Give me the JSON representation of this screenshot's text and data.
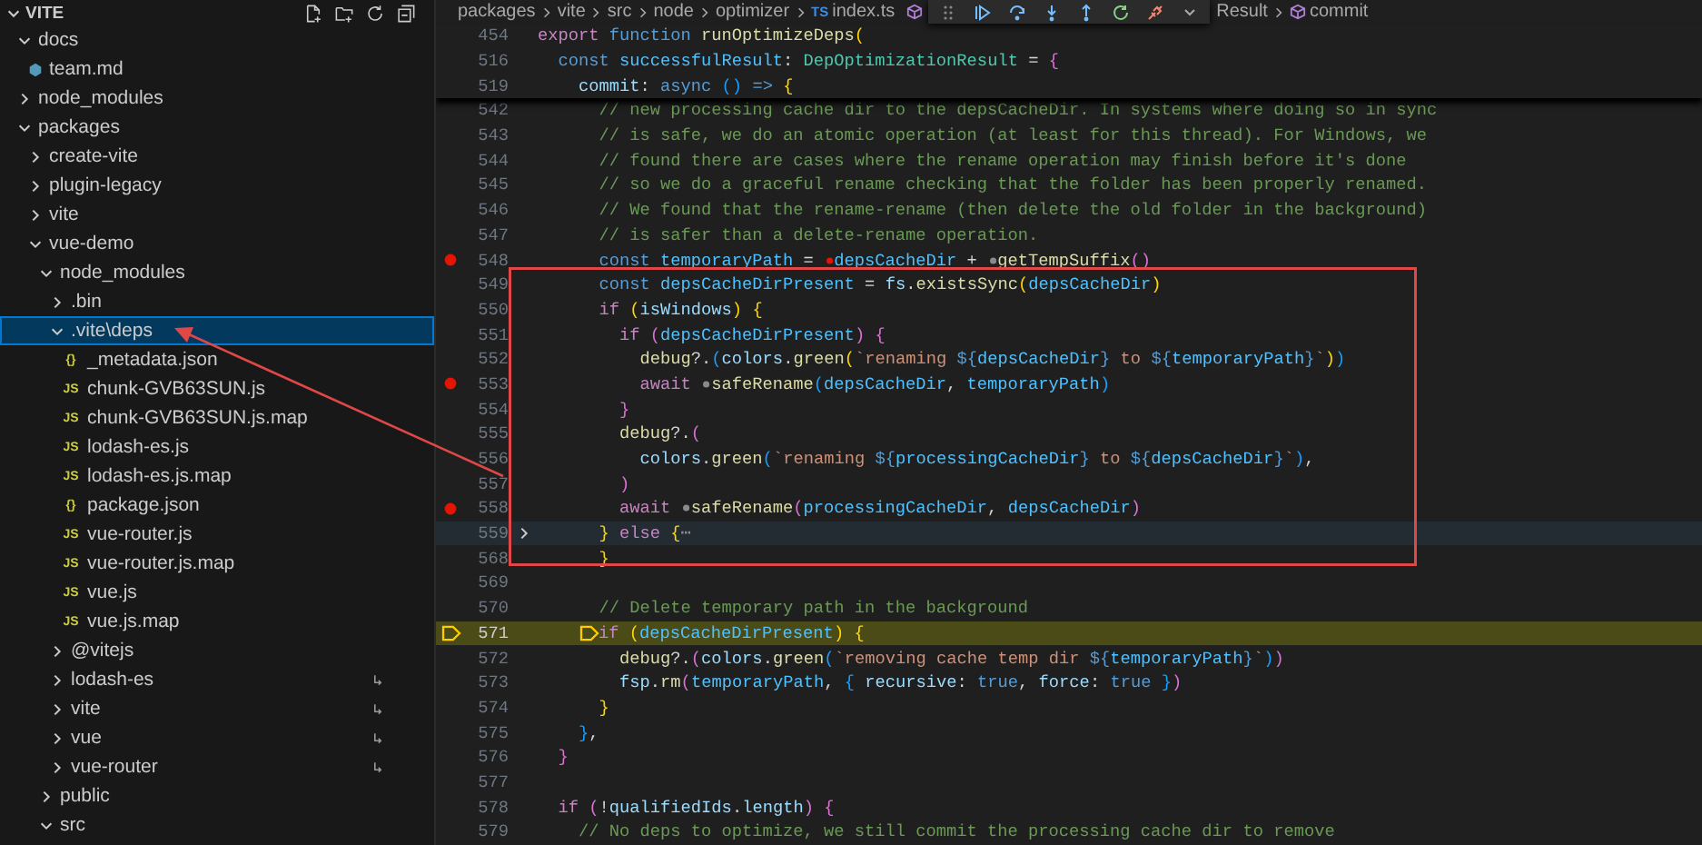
{
  "explorer": {
    "title": "VITE",
    "tree": [
      {
        "label": "docs",
        "kind": "folder",
        "expanded": true,
        "selected": false,
        "children": [
          {
            "label": "team.md",
            "kind": "file",
            "selected": false
          }
        ]
      },
      {
        "label": "node_modules",
        "kind": "folder",
        "expanded": false,
        "selected": false
      },
      {
        "label": "packages",
        "kind": "folder",
        "expanded": true,
        "selected": false,
        "children": [
          {
            "label": "create-vite",
            "kind": "folder",
            "expanded": false,
            "selected": false
          },
          {
            "label": "plugin-legacy",
            "kind": "folder",
            "expanded": false,
            "selected": false
          },
          {
            "label": "vite",
            "kind": "folder",
            "expanded": false,
            "selected": false
          },
          {
            "label": "vue-demo",
            "kind": "folder",
            "expanded": true,
            "selected": false,
            "children": [
              {
                "label": "node_modules",
                "kind": "folder",
                "expanded": true,
                "selected": false,
                "children": [
                  {
                    "label": ".bin",
                    "kind": "folder",
                    "expanded": false,
                    "selected": false,
                    "link": false
                  },
                  {
                    "label": ".vite\\deps",
                    "kind": "folder",
                    "expanded": true,
                    "selected": true,
                    "link": false,
                    "children": [
                      {
                        "label": "_metadata.json",
                        "kind": "file",
                        "badge": "{}",
                        "selected": false
                      },
                      {
                        "label": "chunk-GVB63SUN.js",
                        "kind": "file",
                        "badge": "JS",
                        "selected": false
                      },
                      {
                        "label": "chunk-GVB63SUN.js.map",
                        "kind": "file",
                        "badge": "JS",
                        "selected": false
                      },
                      {
                        "label": "lodash-es.js",
                        "kind": "file",
                        "badge": "JS",
                        "selected": false
                      },
                      {
                        "label": "lodash-es.js.map",
                        "kind": "file",
                        "badge": "JS",
                        "selected": false
                      },
                      {
                        "label": "package.json",
                        "kind": "file",
                        "badge": "{}",
                        "selected": false
                      },
                      {
                        "label": "vue-router.js",
                        "kind": "file",
                        "badge": "JS",
                        "selected": false
                      },
                      {
                        "label": "vue-router.js.map",
                        "kind": "file",
                        "badge": "JS",
                        "selected": false
                      },
                      {
                        "label": "vue.js",
                        "kind": "file",
                        "badge": "JS",
                        "selected": false
                      },
                      {
                        "label": "vue.js.map",
                        "kind": "file",
                        "badge": "JS",
                        "selected": false
                      }
                    ]
                  },
                  {
                    "label": "@vitejs",
                    "kind": "folder",
                    "expanded": false,
                    "selected": false,
                    "link": false
                  },
                  {
                    "label": "lodash-es",
                    "kind": "folder",
                    "expanded": false,
                    "selected": false,
                    "link": true
                  },
                  {
                    "label": "vite",
                    "kind": "folder",
                    "expanded": false,
                    "selected": false,
                    "link": true
                  },
                  {
                    "label": "vue",
                    "kind": "folder",
                    "expanded": false,
                    "selected": false,
                    "link": true
                  },
                  {
                    "label": "vue-router",
                    "kind": "folder",
                    "expanded": false,
                    "selected": false,
                    "link": true
                  }
                ]
              },
              {
                "label": "public",
                "kind": "folder",
                "expanded": false,
                "selected": false
              },
              {
                "label": "src",
                "kind": "folder",
                "expanded": true,
                "selected": false
              }
            ]
          }
        ]
      }
    ]
  },
  "breadcrumbs": [
    {
      "label": "packages",
      "kind": "folder"
    },
    {
      "label": "vite",
      "kind": "folder"
    },
    {
      "label": "src",
      "kind": "folder"
    },
    {
      "label": "node",
      "kind": "folder"
    },
    {
      "label": "optimizer",
      "kind": "folder"
    },
    {
      "label": "index.ts",
      "kind": "file",
      "badge": "TS"
    },
    {
      "label": "Result",
      "kind": "text"
    },
    {
      "label": "commit",
      "kind": "symbol"
    }
  ],
  "sticky_lines": [
    {
      "number": "454",
      "tokens": [
        {
          "kind": "cf",
          "text": "export "
        },
        {
          "kind": "kw",
          "text": "function "
        },
        {
          "kind": "fn",
          "text": "runOptimizeDeps"
        },
        {
          "kind": "b1",
          "text": "("
        }
      ]
    },
    {
      "number": "516",
      "tokens": [
        {
          "kind": "kw",
          "text": "  const "
        },
        {
          "kind": "const",
          "text": "successfulResult"
        },
        {
          "kind": "p",
          "text": ": "
        },
        {
          "kind": "type",
          "text": "DepOptimizationResult"
        },
        {
          "kind": "p",
          "text": " = "
        },
        {
          "kind": "b2",
          "text": "{"
        }
      ]
    },
    {
      "number": "519",
      "tokens": [
        {
          "kind": "var",
          "text": "    commit"
        },
        {
          "kind": "p",
          "text": ": "
        },
        {
          "kind": "kw",
          "text": "async "
        },
        {
          "kind": "b3",
          "text": "()"
        },
        {
          "kind": "kw",
          "text": " => "
        },
        {
          "kind": "b1",
          "text": "{"
        }
      ]
    }
  ],
  "lines": [
    {
      "number": "542",
      "breakpoint": false,
      "current": false,
      "folded": false,
      "tokens": [
        {
          "kind": "com",
          "text": "      // new processing cache dir to the depsCacheDir. In systems where doing so in sync"
        }
      ]
    },
    {
      "number": "543",
      "breakpoint": false,
      "current": false,
      "folded": false,
      "tokens": [
        {
          "kind": "com",
          "text": "      // is safe, we do an atomic operation (at least for this thread). For Windows, we"
        }
      ]
    },
    {
      "number": "544",
      "breakpoint": false,
      "current": false,
      "folded": false,
      "tokens": [
        {
          "kind": "com",
          "text": "      // found there are cases where the rename operation may finish before it's done"
        }
      ]
    },
    {
      "number": "545",
      "breakpoint": false,
      "current": false,
      "folded": false,
      "tokens": [
        {
          "kind": "com",
          "text": "      // so we do a graceful rename checking that the folder has been properly renamed."
        }
      ]
    },
    {
      "number": "546",
      "breakpoint": false,
      "current": false,
      "folded": false,
      "tokens": [
        {
          "kind": "com",
          "text": "      // We found that the rename-rename (then delete the old folder in the background)"
        }
      ]
    },
    {
      "number": "547",
      "breakpoint": false,
      "current": false,
      "folded": false,
      "tokens": [
        {
          "kind": "com",
          "text": "      // is safer than a delete-rename operation."
        }
      ]
    },
    {
      "number": "548",
      "breakpoint": true,
      "current": false,
      "folded": false,
      "tokens": [
        {
          "kind": "kw",
          "text": "      const "
        },
        {
          "kind": "const",
          "text": "temporaryPath"
        },
        {
          "kind": "p",
          "text": " = "
        },
        {
          "kind": "bp",
          "active": true
        },
        {
          "kind": "const",
          "text": "depsCacheDir"
        },
        {
          "kind": "p",
          "text": " + "
        },
        {
          "kind": "bp",
          "active": false
        },
        {
          "kind": "fn",
          "text": "getTempSuffix"
        },
        {
          "kind": "b2",
          "text": "()"
        }
      ]
    },
    {
      "number": "549",
      "breakpoint": false,
      "current": false,
      "folded": false,
      "tokens": [
        {
          "kind": "kw",
          "text": "      const "
        },
        {
          "kind": "const",
          "text": "depsCacheDirPresent"
        },
        {
          "kind": "p",
          "text": " = "
        },
        {
          "kind": "var",
          "text": "fs"
        },
        {
          "kind": "p",
          "text": "."
        },
        {
          "kind": "fn",
          "text": "existsSync"
        },
        {
          "kind": "b1",
          "text": "("
        },
        {
          "kind": "const",
          "text": "depsCacheDir"
        },
        {
          "kind": "b1",
          "text": ")"
        }
      ]
    },
    {
      "number": "550",
      "breakpoint": false,
      "current": false,
      "folded": false,
      "tokens": [
        {
          "kind": "cf",
          "text": "      if "
        },
        {
          "kind": "b1",
          "text": "("
        },
        {
          "kind": "var",
          "text": "isWindows"
        },
        {
          "kind": "b1",
          "text": ") "
        },
        {
          "kind": "b1",
          "text": "{"
        }
      ]
    },
    {
      "number": "551",
      "breakpoint": false,
      "current": false,
      "folded": false,
      "tokens": [
        {
          "kind": "cf",
          "text": "        if "
        },
        {
          "kind": "b2",
          "text": "("
        },
        {
          "kind": "const",
          "text": "depsCacheDirPresent"
        },
        {
          "kind": "b2",
          "text": ") "
        },
        {
          "kind": "b2",
          "text": "{"
        }
      ]
    },
    {
      "number": "552",
      "breakpoint": false,
      "current": false,
      "folded": false,
      "tokens": [
        {
          "kind": "fn",
          "text": "          debug"
        },
        {
          "kind": "p",
          "text": "?."
        },
        {
          "kind": "b3",
          "text": "("
        },
        {
          "kind": "var",
          "text": "colors"
        },
        {
          "kind": "p",
          "text": "."
        },
        {
          "kind": "fn",
          "text": "green"
        },
        {
          "kind": "b1",
          "text": "("
        },
        {
          "kind": "str",
          "text": "`renaming "
        },
        {
          "kind": "tpl",
          "text": "${"
        },
        {
          "kind": "const",
          "text": "depsCacheDir"
        },
        {
          "kind": "tpl",
          "text": "}"
        },
        {
          "kind": "str",
          "text": " to "
        },
        {
          "kind": "tpl",
          "text": "${"
        },
        {
          "kind": "const",
          "text": "temporaryPath"
        },
        {
          "kind": "tpl",
          "text": "}"
        },
        {
          "kind": "str",
          "text": "`"
        },
        {
          "kind": "b1",
          "text": ")"
        },
        {
          "kind": "b3",
          "text": ")"
        }
      ]
    },
    {
      "number": "553",
      "breakpoint": true,
      "current": false,
      "folded": false,
      "tokens": [
        {
          "kind": "cf",
          "text": "          await "
        },
        {
          "kind": "bp",
          "active": false
        },
        {
          "kind": "fn",
          "text": "safeRename"
        },
        {
          "kind": "b3",
          "text": "("
        },
        {
          "kind": "const",
          "text": "depsCacheDir"
        },
        {
          "kind": "p",
          "text": ", "
        },
        {
          "kind": "const",
          "text": "temporaryPath"
        },
        {
          "kind": "b3",
          "text": ")"
        }
      ]
    },
    {
      "number": "554",
      "breakpoint": false,
      "current": false,
      "folded": false,
      "tokens": [
        {
          "kind": "b2",
          "text": "        }"
        }
      ]
    },
    {
      "number": "555",
      "breakpoint": false,
      "current": false,
      "folded": false,
      "tokens": [
        {
          "kind": "fn",
          "text": "        debug"
        },
        {
          "kind": "p",
          "text": "?."
        },
        {
          "kind": "b2",
          "text": "("
        }
      ]
    },
    {
      "number": "556",
      "breakpoint": false,
      "current": false,
      "folded": false,
      "tokens": [
        {
          "kind": "var",
          "text": "          colors"
        },
        {
          "kind": "p",
          "text": "."
        },
        {
          "kind": "fn",
          "text": "green"
        },
        {
          "kind": "b3",
          "text": "("
        },
        {
          "kind": "str",
          "text": "`renaming "
        },
        {
          "kind": "tpl",
          "text": "${"
        },
        {
          "kind": "const",
          "text": "processingCacheDir"
        },
        {
          "kind": "tpl",
          "text": "}"
        },
        {
          "kind": "str",
          "text": " to "
        },
        {
          "kind": "tpl",
          "text": "${"
        },
        {
          "kind": "const",
          "text": "depsCacheDir"
        },
        {
          "kind": "tpl",
          "text": "}"
        },
        {
          "kind": "str",
          "text": "`"
        },
        {
          "kind": "b3",
          "text": ")"
        },
        {
          "kind": "p",
          "text": ","
        }
      ]
    },
    {
      "number": "557",
      "breakpoint": false,
      "current": false,
      "folded": false,
      "tokens": [
        {
          "kind": "b2",
          "text": "        )"
        }
      ]
    },
    {
      "number": "558",
      "breakpoint": true,
      "current": false,
      "folded": false,
      "tokens": [
        {
          "kind": "cf",
          "text": "        await "
        },
        {
          "kind": "bp",
          "active": false
        },
        {
          "kind": "fn",
          "text": "safeRename"
        },
        {
          "kind": "b2",
          "text": "("
        },
        {
          "kind": "const",
          "text": "processingCacheDir"
        },
        {
          "kind": "p",
          "text": ", "
        },
        {
          "kind": "const",
          "text": "depsCacheDir"
        },
        {
          "kind": "b2",
          "text": ")"
        }
      ]
    },
    {
      "number": "559",
      "breakpoint": false,
      "current": false,
      "folded": true,
      "tokens": [
        {
          "kind": "b1",
          "text": "      }"
        },
        {
          "kind": "cf",
          "text": " else "
        },
        {
          "kind": "b1",
          "text": "{"
        },
        {
          "kind": "fold",
          "text": "⋯"
        }
      ]
    },
    {
      "number": "568",
      "breakpoint": false,
      "current": false,
      "folded": false,
      "tokens": [
        {
          "kind": "b1",
          "text": "      }"
        }
      ]
    },
    {
      "number": "569",
      "breakpoint": false,
      "current": false,
      "folded": false
    },
    {
      "number": "570",
      "breakpoint": false,
      "current": false,
      "folded": false,
      "tokens": [
        {
          "kind": "com",
          "text": "      // Delete temporary path in the background"
        }
      ]
    },
    {
      "number": "571",
      "breakpoint": false,
      "current": true,
      "folded": false,
      "tokens": [
        {
          "kind": "stop"
        },
        {
          "kind": "cf",
          "text": "if "
        },
        {
          "kind": "b1",
          "text": "("
        },
        {
          "kind": "const",
          "text": "depsCacheDirPresent"
        },
        {
          "kind": "b1",
          "text": ") "
        },
        {
          "kind": "b1",
          "text": "{"
        }
      ]
    },
    {
      "number": "572",
      "breakpoint": false,
      "current": false,
      "folded": false,
      "tokens": [
        {
          "kind": "fn",
          "text": "        debug"
        },
        {
          "kind": "p",
          "text": "?."
        },
        {
          "kind": "b2",
          "text": "("
        },
        {
          "kind": "var",
          "text": "colors"
        },
        {
          "kind": "p",
          "text": "."
        },
        {
          "kind": "fn",
          "text": "green"
        },
        {
          "kind": "b3",
          "text": "("
        },
        {
          "kind": "str",
          "text": "`removing cache temp dir "
        },
        {
          "kind": "tpl",
          "text": "${"
        },
        {
          "kind": "const",
          "text": "temporaryPath"
        },
        {
          "kind": "tpl",
          "text": "}"
        },
        {
          "kind": "str",
          "text": "`"
        },
        {
          "kind": "b3",
          "text": ")"
        },
        {
          "kind": "b2",
          "text": ")"
        }
      ]
    },
    {
      "number": "573",
      "breakpoint": false,
      "current": false,
      "folded": false,
      "tokens": [
        {
          "kind": "var",
          "text": "        fsp"
        },
        {
          "kind": "p",
          "text": "."
        },
        {
          "kind": "fn",
          "text": "rm"
        },
        {
          "kind": "b2",
          "text": "("
        },
        {
          "kind": "const",
          "text": "temporaryPath"
        },
        {
          "kind": "p",
          "text": ", "
        },
        {
          "kind": "b3",
          "text": "{"
        },
        {
          "kind": "var",
          "text": " recursive"
        },
        {
          "kind": "p",
          "text": ": "
        },
        {
          "kind": "kw",
          "text": "true"
        },
        {
          "kind": "p",
          "text": ", "
        },
        {
          "kind": "var",
          "text": "force"
        },
        {
          "kind": "p",
          "text": ": "
        },
        {
          "kind": "kw",
          "text": "true"
        },
        {
          "kind": "b3",
          "text": " }"
        },
        {
          "kind": "b2",
          "text": ")"
        }
      ]
    },
    {
      "number": "574",
      "breakpoint": false,
      "current": false,
      "folded": false,
      "tokens": [
        {
          "kind": "b1",
          "text": "      }"
        }
      ]
    },
    {
      "number": "575",
      "breakpoint": false,
      "current": false,
      "folded": false,
      "tokens": [
        {
          "kind": "b3",
          "text": "    }"
        },
        {
          "kind": "p",
          "text": ","
        }
      ]
    },
    {
      "number": "576",
      "breakpoint": false,
      "current": false,
      "folded": false,
      "tokens": [
        {
          "kind": "b2",
          "text": "  }"
        }
      ]
    },
    {
      "number": "577",
      "breakpoint": false,
      "current": false,
      "folded": false
    },
    {
      "number": "578",
      "breakpoint": false,
      "current": false,
      "folded": false,
      "tokens": [
        {
          "kind": "cf",
          "text": "  if "
        },
        {
          "kind": "b2",
          "text": "("
        },
        {
          "kind": "p",
          "text": "!"
        },
        {
          "kind": "var",
          "text": "qualifiedIds"
        },
        {
          "kind": "p",
          "text": "."
        },
        {
          "kind": "var",
          "text": "length"
        },
        {
          "kind": "b2",
          "text": ") "
        },
        {
          "kind": "b2",
          "text": "{"
        }
      ]
    },
    {
      "number": "579",
      "breakpoint": false,
      "current": false,
      "folded": false,
      "tokens": [
        {
          "kind": "com",
          "text": "    // No deps to optimize, we still commit the processing cache dir to remove"
        }
      ]
    }
  ],
  "annotation": {
    "box": true,
    "arrow": true
  }
}
